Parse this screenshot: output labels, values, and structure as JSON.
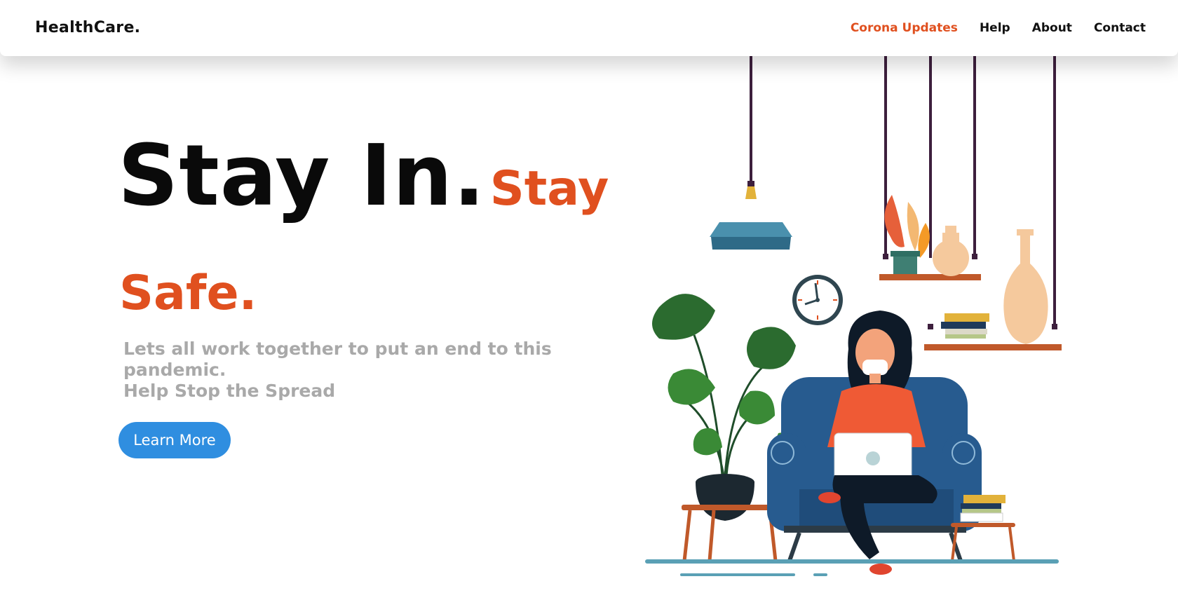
{
  "navbar": {
    "brand": "HealthCare.",
    "links": [
      "Corona Updates",
      "Help",
      "About",
      "Contact"
    ]
  },
  "hero": {
    "title_black": "Stay In.",
    "title_orange_1": "Stay",
    "title_orange_2": "Safe.",
    "subtitle_line1": "Lets all work together to put an end to this pandemic.",
    "subtitle_line2": "Help Stop the Spread",
    "button_label": "Learn More"
  },
  "colors": {
    "accent": "#e0501f",
    "button": "#2f8ee0",
    "subtitle": "#a9a9a9",
    "text": "#0a0a0a"
  },
  "icons": {
    "illustration": "woman-on-armchair-with-laptop-illustration"
  }
}
